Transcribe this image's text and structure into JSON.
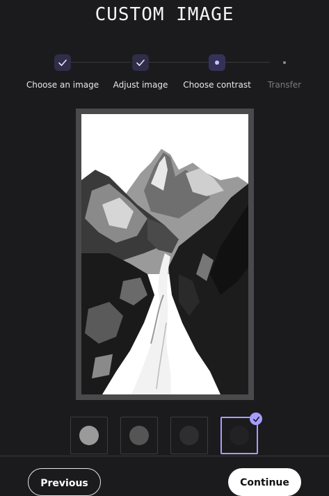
{
  "page": {
    "title": "CUSTOM IMAGE"
  },
  "stepper": {
    "steps": [
      {
        "label": "Choose an image",
        "state": "done"
      },
      {
        "label": "Adjust image",
        "state": "done"
      },
      {
        "label": "Choose contrast",
        "state": "current"
      },
      {
        "label": "Transfer",
        "state": "todo"
      }
    ]
  },
  "preview": {
    "alt": "mountain-trail-image"
  },
  "contrast": {
    "options": [
      {
        "color": "#9a9a9a",
        "selected": false
      },
      {
        "color": "#555555",
        "selected": false
      },
      {
        "color": "#2e2e2e",
        "selected": false
      },
      {
        "color": "#222224",
        "selected": true
      }
    ]
  },
  "footer": {
    "previous_label": "Previous",
    "continue_label": "Continue"
  },
  "colors": {
    "accent": "#a79dff",
    "background": "#1b1b1d"
  }
}
